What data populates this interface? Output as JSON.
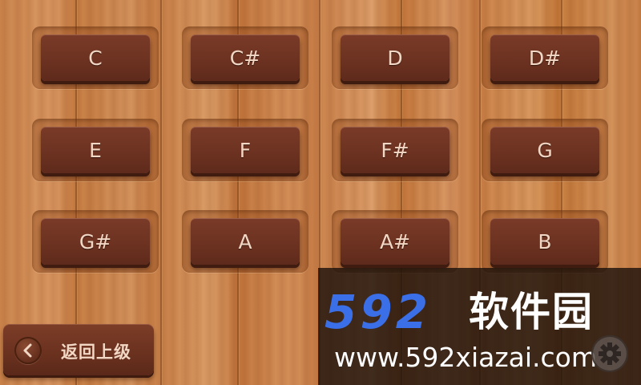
{
  "keys": [
    {
      "label": "C"
    },
    {
      "label": "C#"
    },
    {
      "label": "D"
    },
    {
      "label": "D#"
    },
    {
      "label": "E"
    },
    {
      "label": "F"
    },
    {
      "label": "F#"
    },
    {
      "label": "G"
    },
    {
      "label": "G#"
    },
    {
      "label": "A"
    },
    {
      "label": "A#"
    },
    {
      "label": "B"
    }
  ],
  "back_button": {
    "label": "返回上级",
    "icon": "chevron-left-icon"
  },
  "settings_button": {
    "icon": "gear-icon"
  },
  "watermark": {
    "logo_number": "592",
    "logo_text": "软件园",
    "url": "www.592xiazai.com"
  },
  "colors": {
    "key_face": "#6d3221",
    "key_text": "#f1d7c4",
    "wood": "#cf8a52",
    "watermark_blue": "#3a6fe8"
  }
}
